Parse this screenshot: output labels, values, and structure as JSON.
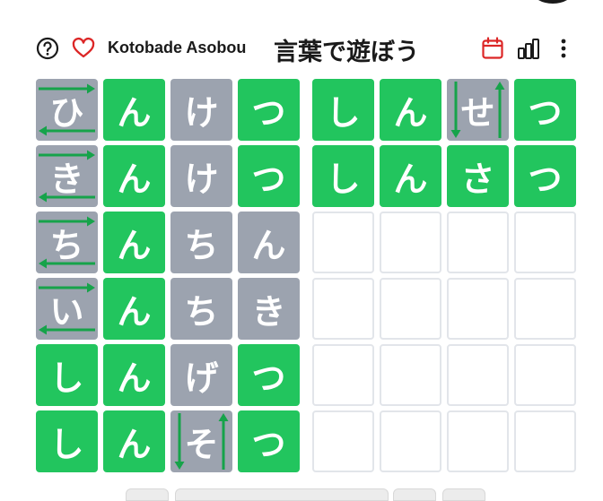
{
  "header": {
    "app_name": "Kotobade Asobou",
    "title": "言葉で遊ぼう",
    "icons": [
      "help-icon",
      "heart-icon",
      "calendar-icon",
      "stats-icon",
      "more-icon"
    ],
    "accent_color": "#dc2626"
  },
  "colors": {
    "correct": "#22c55e",
    "absent": "#9ca3af",
    "empty_border": "#e2e5ea",
    "arrow": "#16a34a"
  },
  "board_left": [
    [
      {
        "ch": "ひ",
        "s": "absent",
        "a": "h"
      },
      {
        "ch": "ん",
        "s": "correct"
      },
      {
        "ch": "け",
        "s": "absent"
      },
      {
        "ch": "つ",
        "s": "correct"
      }
    ],
    [
      {
        "ch": "き",
        "s": "absent",
        "a": "h"
      },
      {
        "ch": "ん",
        "s": "correct"
      },
      {
        "ch": "け",
        "s": "absent"
      },
      {
        "ch": "つ",
        "s": "correct"
      }
    ],
    [
      {
        "ch": "ち",
        "s": "absent",
        "a": "h"
      },
      {
        "ch": "ん",
        "s": "correct"
      },
      {
        "ch": "ち",
        "s": "absent"
      },
      {
        "ch": "ん",
        "s": "absent"
      }
    ],
    [
      {
        "ch": "い",
        "s": "absent",
        "a": "h"
      },
      {
        "ch": "ん",
        "s": "correct"
      },
      {
        "ch": "ち",
        "s": "absent"
      },
      {
        "ch": "き",
        "s": "absent"
      }
    ],
    [
      {
        "ch": "し",
        "s": "correct"
      },
      {
        "ch": "ん",
        "s": "correct"
      },
      {
        "ch": "げ",
        "s": "absent"
      },
      {
        "ch": "つ",
        "s": "correct"
      }
    ],
    [
      {
        "ch": "し",
        "s": "correct"
      },
      {
        "ch": "ん",
        "s": "correct"
      },
      {
        "ch": "そ",
        "s": "absent",
        "a": "v"
      },
      {
        "ch": "つ",
        "s": "correct"
      }
    ]
  ],
  "board_right": [
    [
      {
        "ch": "し",
        "s": "correct"
      },
      {
        "ch": "ん",
        "s": "correct"
      },
      {
        "ch": "せ",
        "s": "absent",
        "a": "v"
      },
      {
        "ch": "つ",
        "s": "correct"
      }
    ],
    [
      {
        "ch": "し",
        "s": "correct"
      },
      {
        "ch": "ん",
        "s": "correct"
      },
      {
        "ch": "さ",
        "s": "correct"
      },
      {
        "ch": "つ",
        "s": "correct"
      }
    ],
    [
      {
        "ch": "",
        "s": "empty"
      },
      {
        "ch": "",
        "s": "empty"
      },
      {
        "ch": "",
        "s": "empty"
      },
      {
        "ch": "",
        "s": "empty"
      }
    ],
    [
      {
        "ch": "",
        "s": "empty"
      },
      {
        "ch": "",
        "s": "empty"
      },
      {
        "ch": "",
        "s": "empty"
      },
      {
        "ch": "",
        "s": "empty"
      }
    ],
    [
      {
        "ch": "",
        "s": "empty"
      },
      {
        "ch": "",
        "s": "empty"
      },
      {
        "ch": "",
        "s": "empty"
      },
      {
        "ch": "",
        "s": "empty"
      }
    ],
    [
      {
        "ch": "",
        "s": "empty"
      },
      {
        "ch": "",
        "s": "empty"
      },
      {
        "ch": "",
        "s": "empty"
      },
      {
        "ch": "",
        "s": "empty"
      }
    ]
  ]
}
